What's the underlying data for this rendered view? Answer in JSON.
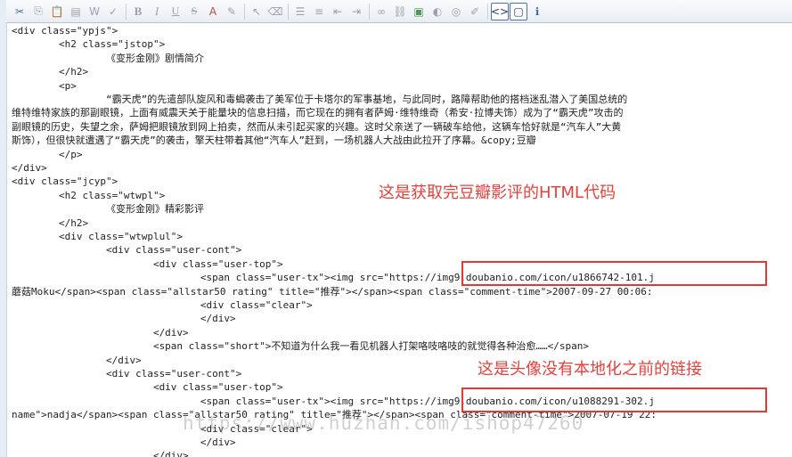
{
  "toolbar": {
    "buttons": [
      {
        "name": "cut-icon",
        "glyph": "✂"
      },
      {
        "name": "copy-icon",
        "glyph": "⎘"
      },
      {
        "name": "paste-icon",
        "glyph": "📋"
      },
      {
        "name": "paste-text-icon",
        "glyph": "▤"
      },
      {
        "name": "paste-word-icon",
        "glyph": "W"
      },
      {
        "name": "spellcheck-icon",
        "glyph": "✓"
      },
      {
        "name": "bold-icon",
        "glyph": "B"
      },
      {
        "name": "italic-icon",
        "glyph": "I"
      },
      {
        "name": "underline-icon",
        "glyph": "U"
      },
      {
        "name": "strikethrough-icon",
        "glyph": "S"
      },
      {
        "name": "text-color-icon",
        "glyph": "A"
      },
      {
        "name": "highlight-icon",
        "glyph": "✎"
      },
      {
        "name": "select-icon",
        "glyph": "↖"
      },
      {
        "name": "eraser-icon",
        "glyph": "⌫"
      },
      {
        "name": "unordered-list-icon",
        "glyph": "☰"
      },
      {
        "name": "ordered-list-icon",
        "glyph": "≡"
      },
      {
        "name": "outdent-icon",
        "glyph": "⇤"
      },
      {
        "name": "indent-icon",
        "glyph": "⇥"
      },
      {
        "name": "link-icon",
        "glyph": "∞"
      },
      {
        "name": "unlink-icon",
        "glyph": "⛓"
      },
      {
        "name": "image-icon",
        "glyph": "▣"
      },
      {
        "name": "flash-icon",
        "glyph": "◐"
      },
      {
        "name": "media-icon",
        "glyph": "◎"
      },
      {
        "name": "edit-icon",
        "glyph": "✐"
      },
      {
        "name": "source-code-icon",
        "glyph": "<>"
      },
      {
        "name": "preview-icon",
        "glyph": "▢"
      },
      {
        "name": "about-icon",
        "glyph": "ℹ"
      }
    ]
  },
  "code": {
    "lines": [
      "<div class=\"ypjs\">",
      "        <h2 class=\"jstop\">",
      "                《变形金刚》剧情简介",
      "        </h2>",
      "        <p>",
      "                “霸天虎”的先遣部队旋风和毒蝎袭击了美军位于卡塔尔的军事基地，与此同时，路障帮助他的搭档迷乱潜入了美国总统的",
      "维特维特家族的那副眼镜，上面有威震天关于能量块的信息扫描，而它现在的拥有者萨姆·维特维奇（希安·拉博夫饰）成为了“霸天虎”攻击的",
      "副眼镜的历史，失望之余，萨姆把眼镜放到网上拍卖，然而从未引起买家的兴趣。这时父亲送了一辆破车给他，这辆车恰好就是“汽车人”大黄",
      "斯饰），但很快就遭遇了“霸天虎”的袭击，擎天柱带着其他“汽车人”赶到，一场机器人大战由此拉开了序幕。&copy;豆瓣",
      "        </p>",
      "</div>",
      "<div class=\"jcyp\">",
      "        <h2 class=\"wtwpl\">",
      "                《变形金刚》精彩影评",
      "        </h2>",
      "        <div class=\"wtwplul\">",
      "                <div class=\"user-cont\">",
      "                        <div class=\"user-top\">",
      "                                <span class=\"user-tx\"><img src=\"https://img9.doubanio.com/icon/u1866742-101.j",
      "蘑菇Moku</span><span class=\"allstar50 rating\" title=\"推荐\"></span><span class=\"comment-time\">2007-09-27 00:06:",
      "                                <div class=\"clear\">",
      "                                </div>",
      "                        </div>",
      "                        <span class=\"short\">不知道为什么我一看见机器人打架咯吱咯吱的就觉得各种治愈……</span>",
      "                </div>",
      "                <div class=\"user-cont\">",
      "                        <div class=\"user-top\">",
      "                                <span class=\"user-tx\"><img src=\"https://img9.doubanio.com/icon/u1088291-302.j",
      "name\">nadja</span><span class=\"allstar50 rating\" title=\"推荐\"></span><span class=\"comment-time\">2007-07-19 22:",
      "                                <div class=\"clear\">",
      "                                </div>",
      "                        </div>"
    ]
  },
  "annotations": {
    "html_code_note": "这是获取完豆瓣影评的HTML代码",
    "avatar_link_note": "这是头像没有本地化之前的链接"
  },
  "watermark": "https://www.huzhan.com/ishop47260",
  "colors": {
    "annotation": "#e8403a",
    "highlight_box": "#e23a33"
  }
}
